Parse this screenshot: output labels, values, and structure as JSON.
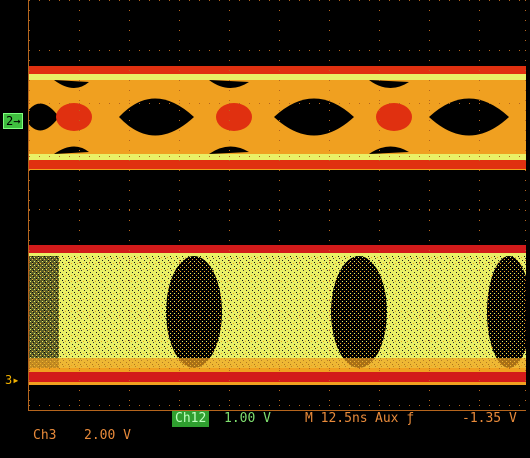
{
  "markers": {
    "ch2": "2",
    "ch3": "3"
  },
  "status": {
    "ch12_label": "Ch12",
    "ch12_scale": "1.00 V",
    "timebase": "M 12.5ns",
    "trigger_source": "Aux",
    "trigger_slope_icon": "rising-edge-icon",
    "trigger_level": "-1.35 V",
    "ch3_label": "Ch3",
    "ch3_scale": "2.00 V"
  },
  "colors": {
    "background": "#000000",
    "graticule": "#b5651d",
    "persistence_low": "#e9f066",
    "persistence_mid": "#f0a020",
    "persistence_high": "#e03010",
    "rail": "#d21a1a",
    "ch2_marker": "#3fbf3f",
    "ch3_marker": "#f0b000"
  }
}
